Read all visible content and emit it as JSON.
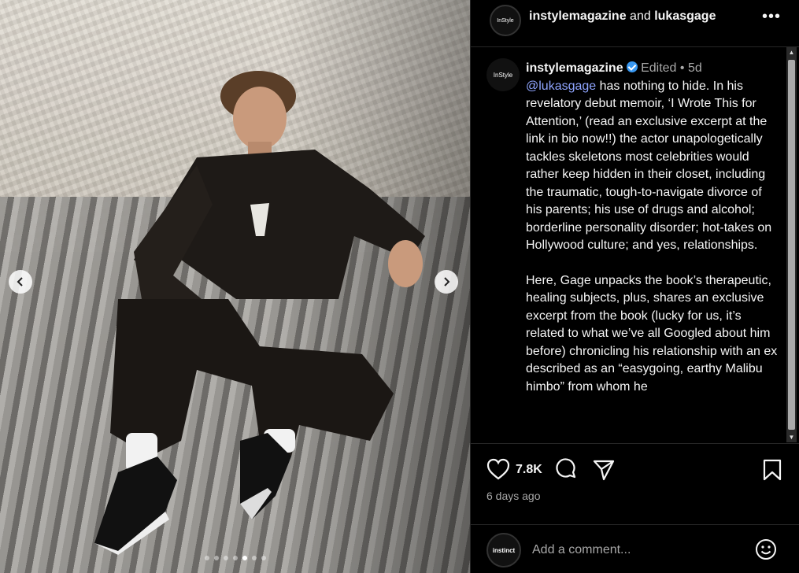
{
  "post": {
    "image_alt": "Man in dark jumpsuit sitting in truck bed",
    "carousel_dots": 7,
    "carousel_active_index": 4
  },
  "header": {
    "avatar_text": "InStyle",
    "user1": "instylemagazine",
    "joiner": " and ",
    "user2": "lukasgage",
    "more_icon": "more-horizontal-icon"
  },
  "caption": {
    "avatar_text": "InStyle",
    "username": "instylemagazine",
    "edited": "Edited",
    "bullet": " • ",
    "age": "5d",
    "mention": "@lukasgage",
    "para1": " has nothing to hide. In his revelatory debut memoir, ‘I Wrote This for Attention,’ (read an exclusive excerpt at the link in bio now!!) the actor unapologetically tackles skeletons most celebrities would rather keep hidden in their closet, including the traumatic, tough-to-navigate divorce of his parents; his use of drugs and alcohol; borderline personality disorder; hot-takes on Hollywood culture; and yes, relationships.",
    "para2": "Here, Gage unpacks the book’s therapeutic, healing subjects, plus, shares an exclusive excerpt from the book (lucky for us, it’s related to what we’ve all Googled about him before) chronicling his relationship with an ex described as an “easygoing, earthy Malibu himbo” from whom he"
  },
  "actions": {
    "like_count": "7.8K",
    "time": "6 days ago"
  },
  "comment": {
    "avatar_text": "instinct",
    "placeholder": "Add a comment..."
  },
  "colors": {
    "background": "#000000",
    "mention": "#8fa5ff",
    "verified": "#3897f0",
    "muted": "#a8a8a8"
  }
}
